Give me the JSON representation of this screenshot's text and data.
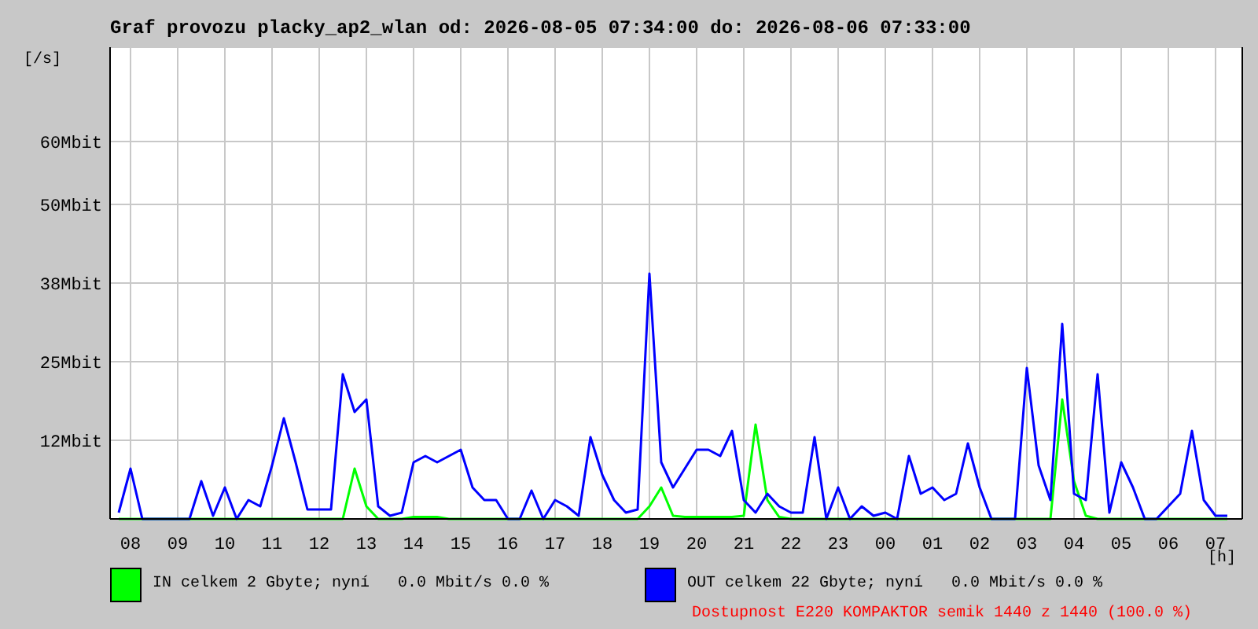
{
  "title": "Graf provozu placky_ap2_wlan od: 2026-08-05 07:34:00 do: 2026-08-06 07:33:00",
  "chart_data": {
    "type": "line",
    "ylabel": "[/s]",
    "xlabel": "[h]",
    "categories": [
      null,
      "08",
      null,
      null,
      null,
      "09",
      null,
      null,
      null,
      "10",
      null,
      null,
      null,
      "11",
      null,
      null,
      null,
      "12",
      null,
      null,
      null,
      "13",
      null,
      null,
      null,
      "14",
      null,
      null,
      null,
      "15",
      null,
      null,
      null,
      "16",
      null,
      null,
      null,
      "17",
      null,
      null,
      null,
      "18",
      null,
      null,
      null,
      "19",
      null,
      null,
      null,
      "20",
      null,
      null,
      null,
      "21",
      null,
      null,
      null,
      "22",
      null,
      null,
      null,
      "23",
      null,
      null,
      null,
      "00",
      null,
      null,
      null,
      "01",
      null,
      null,
      null,
      "02",
      null,
      null,
      null,
      "03",
      null,
      null,
      null,
      "04",
      null,
      null,
      null,
      "05",
      null,
      null,
      null,
      "06",
      null,
      null,
      null,
      "07",
      null
    ],
    "series": [
      {
        "name": "IN",
        "color": "#00ff00",
        "values": [
          0,
          0,
          0,
          0,
          0,
          0,
          0,
          0,
          0,
          0,
          0,
          0,
          0,
          0,
          0,
          0,
          0,
          0,
          0,
          0,
          8,
          2,
          0,
          0,
          0,
          0.3,
          0.3,
          0.3,
          0,
          0,
          0,
          0,
          0,
          0,
          0,
          0,
          0,
          0,
          0,
          0,
          0,
          0,
          0,
          0,
          0,
          2,
          5,
          0.5,
          0.3,
          0.3,
          0.3,
          0.3,
          0.3,
          0.5,
          15,
          3,
          0.3,
          0,
          0,
          0,
          0,
          0,
          0,
          0,
          0,
          0,
          0,
          0,
          0,
          0,
          0,
          0,
          0,
          0,
          0,
          0,
          0,
          0,
          0,
          0,
          19,
          6,
          0.5,
          0,
          0,
          0,
          0,
          0,
          0,
          0,
          0,
          0,
          0,
          0,
          0
        ]
      },
      {
        "name": "OUT",
        "color": "#0000ff",
        "values": [
          1,
          8,
          0,
          0,
          0,
          0,
          0,
          6,
          0.5,
          5,
          0,
          3,
          2,
          8.5,
          16,
          9,
          1.5,
          1.5,
          1.5,
          23,
          17,
          19,
          2,
          0.5,
          1,
          9,
          10,
          9,
          10,
          11,
          5,
          3,
          3,
          0,
          0,
          4.5,
          0,
          3,
          2,
          0.5,
          13,
          7,
          3,
          1,
          1.5,
          39,
          9,
          5,
          8,
          11,
          11,
          10,
          14,
          3,
          1,
          4,
          2,
          1,
          1,
          13,
          0,
          5,
          0,
          2,
          0.5,
          1,
          0,
          10,
          4,
          5,
          3,
          4,
          12,
          5,
          0,
          0,
          0,
          24,
          8.5,
          3,
          31,
          4,
          3,
          23,
          1,
          9,
          5,
          0,
          0,
          2,
          4,
          14,
          3,
          0.5,
          0.5
        ]
      }
    ],
    "ylim": [
      0,
      75
    ],
    "grid": true,
    "yticks": [
      {
        "value": 12.5,
        "label": "12Mbit"
      },
      {
        "value": 25,
        "label": "25Mbit"
      },
      {
        "value": 37.5,
        "label": "38Mbit"
      },
      {
        "value": 50,
        "label": "50Mbit"
      },
      {
        "value": 60,
        "label": "60Mbit"
      }
    ]
  },
  "legend": [
    {
      "text": "celkem 2 Gbyte; nyní   0.0 Mbit/s 0.0 %"
    },
    {
      "text": "celkem 22 Gbyte; nyní   0.0 Mbit/s 0.0 %"
    }
  ],
  "availability": "Dostupnost E220 KOMPAKTOR semik 1440 z 1440 (100.0 %)"
}
